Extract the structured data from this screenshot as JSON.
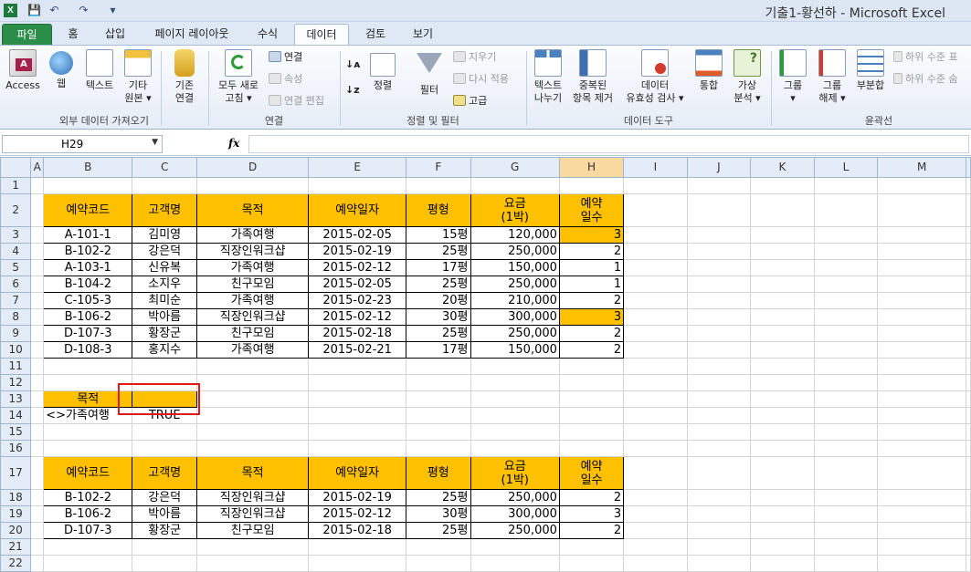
{
  "window": {
    "app_icon": "X",
    "title": "기출1-황선하  -  Microsoft Excel"
  },
  "qat": [
    "save-icon",
    "undo-icon",
    "redo-icon",
    "customize-icon"
  ],
  "tabs": [
    "파일",
    "홈",
    "삽입",
    "페이지 레이아웃",
    "수식",
    "데이터",
    "검토",
    "보기"
  ],
  "active_tab": "데이터",
  "ribbon": {
    "external": {
      "label": "외부 데이터 가져오기",
      "access": "Access",
      "web": "웹",
      "text": "텍스트",
      "other_line1": "기타",
      "other_line2": "원본",
      "existing_line1": "기존",
      "existing_line2": "연결"
    },
    "connections": {
      "label": "연결",
      "refresh_line1": "모두 새로",
      "refresh_line2": "고침",
      "connections": "연결",
      "properties": "속성",
      "edit_links": "연결 편집"
    },
    "sort_filter": {
      "label": "정렬 및 필터",
      "sort": "정렬",
      "filter": "필터",
      "clear": "지우기",
      "reapply": "다시 적용",
      "advanced": "고급"
    },
    "data_tools": {
      "label": "데이터 도구",
      "text_to_cols_line1": "텍스트",
      "text_to_cols_line2": "나누기",
      "remove_dup_line1": "중복된",
      "remove_dup_line2": "항목 제거",
      "validation_line1": "데이터",
      "validation_line2": "유효성 검사",
      "consolidate": "통합",
      "whatif_line1": "가상",
      "whatif_line2": "분석"
    },
    "outline": {
      "label": "윤곽선",
      "group": "그룹",
      "ungroup_line1": "그룹",
      "ungroup_line2": "해제",
      "subtotal": "부분합",
      "show_detail": "하위 수준 표",
      "hide_detail": "하위 수준 숨"
    }
  },
  "formula_bar": {
    "name_box": "H29",
    "fx": "fx",
    "content": ""
  },
  "columns": [
    "A",
    "B",
    "C",
    "D",
    "E",
    "F",
    "G",
    "H",
    "I",
    "J",
    "K",
    "L",
    "M"
  ],
  "selected_column": "H",
  "table1": {
    "headers": [
      "예약코드",
      "고객명",
      "목적",
      "예약일자",
      "평형",
      "요금\n(1박)",
      "예약\n일수"
    ],
    "rows": [
      [
        "A-101-1",
        "김미영",
        "가족여행",
        "2015-02-05",
        "15평",
        "120,000",
        "3"
      ],
      [
        "B-102-2",
        "강은덕",
        "직장인워크샵",
        "2015-02-19",
        "25평",
        "250,000",
        "2"
      ],
      [
        "A-103-1",
        "신유복",
        "가족여행",
        "2015-02-12",
        "17평",
        "150,000",
        "1"
      ],
      [
        "B-104-2",
        "소지우",
        "친구모임",
        "2015-02-05",
        "25평",
        "250,000",
        "1"
      ],
      [
        "C-105-3",
        "최미순",
        "가족여행",
        "2015-02-23",
        "20평",
        "210,000",
        "2"
      ],
      [
        "B-106-2",
        "박아름",
        "직장인워크샵",
        "2015-02-12",
        "30평",
        "300,000",
        "3"
      ],
      [
        "D-107-3",
        "황장군",
        "친구모임",
        "2015-02-18",
        "25평",
        "250,000",
        "2"
      ],
      [
        "D-108-3",
        "홍지수",
        "가족여행",
        "2015-02-21",
        "17평",
        "150,000",
        "2"
      ]
    ],
    "highlight_rows": [
      0,
      5
    ]
  },
  "criteria": {
    "label": "목적",
    "value": "",
    "b14": "<>가족여행",
    "c14": "TRUE"
  },
  "table2": {
    "headers": [
      "예약코드",
      "고객명",
      "목적",
      "예약일자",
      "평형",
      "요금\n(1박)",
      "예약\n일수"
    ],
    "rows": [
      [
        "B-102-2",
        "강은덕",
        "직장인워크샵",
        "2015-02-19",
        "25평",
        "250,000",
        "2"
      ],
      [
        "B-106-2",
        "박아름",
        "직장인워크샵",
        "2015-02-12",
        "30평",
        "300,000",
        "3"
      ],
      [
        "D-107-3",
        "황장군",
        "친구모임",
        "2015-02-18",
        "25평",
        "250,000",
        "2"
      ]
    ]
  },
  "colors": {
    "header_fill": "#ffc000",
    "highlight_fill": "#ffc000",
    "file_tab": "#2a8d48",
    "selection_box": "#e01919"
  }
}
